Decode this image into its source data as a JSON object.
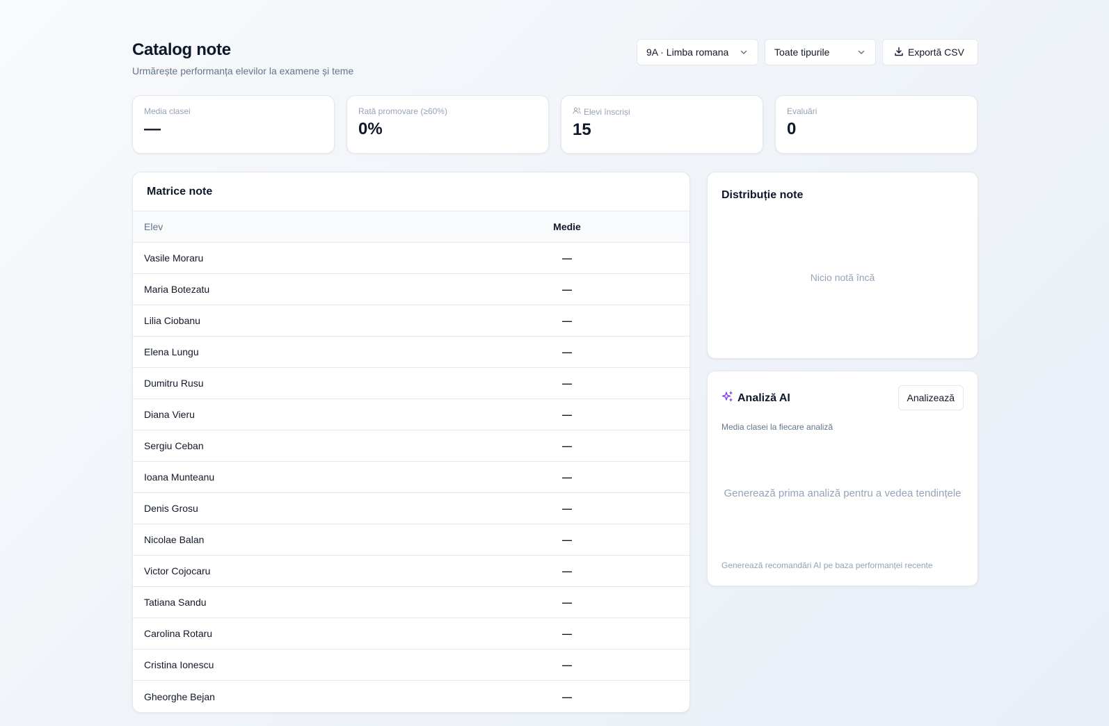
{
  "header": {
    "title": "Catalog note",
    "subtitle": "Urmărește performanța elevilor la examene și teme",
    "class_select": {
      "value": "9A · Limba romana",
      "icon": "chevron-down-icon"
    },
    "type_select": {
      "value": "Toate tipurile",
      "icon": "chevron-down-icon"
    },
    "export_button": {
      "label": "Exportă CSV",
      "icon": "download-icon"
    }
  },
  "stats": [
    {
      "label": "Media clasei",
      "value": "—"
    },
    {
      "label": "Rată promovare (≥60%)",
      "value": "0%"
    },
    {
      "label": "Elevi înscriși",
      "value": "15",
      "icon": "users-icon"
    },
    {
      "label": "Evaluări",
      "value": "0"
    }
  ],
  "matrix": {
    "title": "Matrice note",
    "columns": [
      "Elev",
      "Medie"
    ],
    "rows": [
      {
        "name": "Vasile Moraru",
        "avg": "—"
      },
      {
        "name": "Maria Botezatu",
        "avg": "—"
      },
      {
        "name": "Lilia Ciobanu",
        "avg": "—"
      },
      {
        "name": "Elena Lungu",
        "avg": "—"
      },
      {
        "name": "Dumitru Rusu",
        "avg": "—"
      },
      {
        "name": "Diana Vieru",
        "avg": "—"
      },
      {
        "name": "Sergiu Ceban",
        "avg": "—"
      },
      {
        "name": "Ioana Munteanu",
        "avg": "—"
      },
      {
        "name": "Denis Grosu",
        "avg": "—"
      },
      {
        "name": "Nicolae Balan",
        "avg": "—"
      },
      {
        "name": "Victor Cojocaru",
        "avg": "—"
      },
      {
        "name": "Tatiana Sandu",
        "avg": "—"
      },
      {
        "name": "Carolina Rotaru",
        "avg": "—"
      },
      {
        "name": "Cristina Ionescu",
        "avg": "—"
      },
      {
        "name": "Gheorghe Bejan",
        "avg": "—"
      }
    ]
  },
  "distribution": {
    "title": "Distribuție note",
    "empty": "Nicio notă încă"
  },
  "ai": {
    "title": "Analiză AI",
    "icon": "sparkles-icon",
    "button": "Analizează",
    "caption": "Media clasei la fiecare analiză",
    "empty": "Generează prima analiză pentru a vedea tendințele",
    "footer": "Generează recomandări AI pe baza performanței recente"
  },
  "colors": {
    "accent": "#7c3aed",
    "muted": "#94a3b8"
  }
}
